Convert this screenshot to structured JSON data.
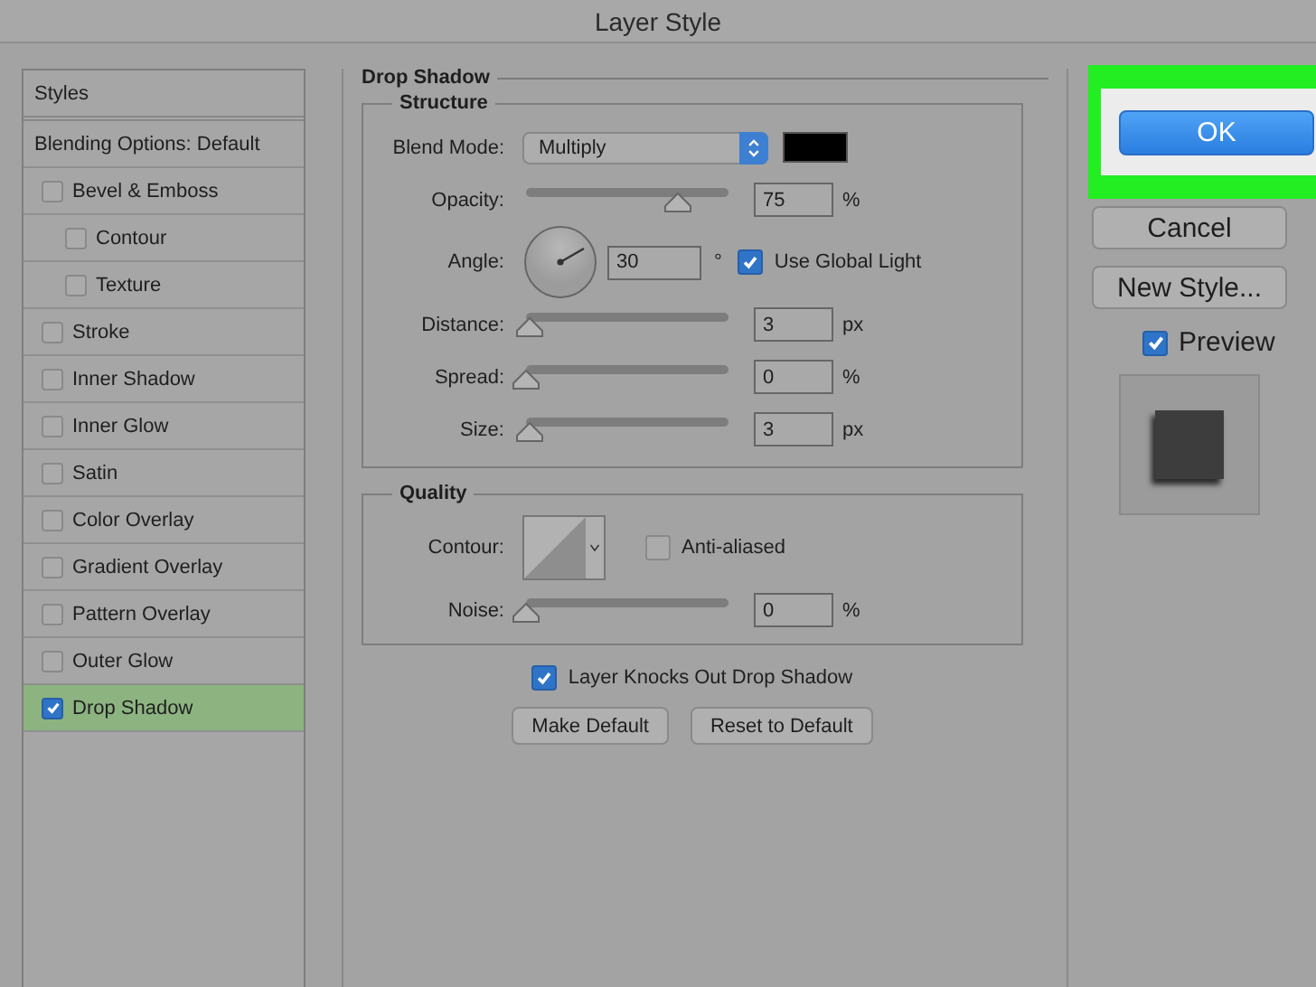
{
  "window": {
    "title": "Layer Style"
  },
  "sidebar": {
    "header": "Styles",
    "items": [
      {
        "label": "Blending Options: Default",
        "kind": "plain",
        "selected": false
      },
      {
        "label": "Bevel & Emboss",
        "kind": "check",
        "checked": false,
        "selected": false,
        "children": [
          {
            "label": "Contour",
            "kind": "check",
            "checked": false,
            "selected": false
          },
          {
            "label": "Texture",
            "kind": "check",
            "checked": false,
            "selected": false
          }
        ]
      },
      {
        "label": "Stroke",
        "kind": "check",
        "checked": false,
        "selected": false
      },
      {
        "label": "Inner Shadow",
        "kind": "check",
        "checked": false,
        "selected": false
      },
      {
        "label": "Inner Glow",
        "kind": "check",
        "checked": false,
        "selected": false
      },
      {
        "label": "Satin",
        "kind": "check",
        "checked": false,
        "selected": false
      },
      {
        "label": "Color Overlay",
        "kind": "check",
        "checked": false,
        "selected": false
      },
      {
        "label": "Gradient Overlay",
        "kind": "check",
        "checked": false,
        "selected": false
      },
      {
        "label": "Pattern Overlay",
        "kind": "check",
        "checked": false,
        "selected": false
      },
      {
        "label": "Outer Glow",
        "kind": "check",
        "checked": false,
        "selected": false
      },
      {
        "label": "Drop Shadow",
        "kind": "check",
        "checked": true,
        "selected": true
      }
    ]
  },
  "drop_shadow": {
    "title": "Drop Shadow",
    "structure": {
      "title": "Structure",
      "rows": [
        {
          "kind": "select",
          "label": "Blend Mode:",
          "value": "Multiply"
        },
        {
          "kind": "slider",
          "label": "Opacity:",
          "level": 0.75,
          "value": "75",
          "unit": "%"
        },
        {
          "kind": "angle",
          "label": "Angle:",
          "value": "30",
          "unit": "°",
          "checkbox": {
            "label": "Use Global Light",
            "checked": true
          }
        },
        {
          "kind": "slider",
          "label": "Distance:",
          "level": 0.02,
          "value": "3",
          "unit": "px"
        },
        {
          "kind": "slider",
          "label": "Spread:",
          "level": 0,
          "value": "0",
          "unit": "%"
        },
        {
          "kind": "slider",
          "label": "Size:",
          "level": 0.02,
          "value": "3",
          "unit": "px"
        }
      ]
    },
    "quality": {
      "title": "Quality",
      "rows": [
        {
          "kind": "contour",
          "label": "Contour:",
          "checkbox": {
            "label": "Anti-aliased",
            "checked": false
          }
        },
        {
          "kind": "slider",
          "label": "Noise:",
          "level": 0,
          "value": "0",
          "unit": "%"
        }
      ]
    },
    "knockout": {
      "label": "Layer Knocks Out Drop Shadow",
      "checked": true
    },
    "buttons": [
      "Make Default",
      "Reset to Default"
    ]
  },
  "actions": [
    {
      "label": "OK",
      "primary": true
    },
    {
      "label": "Cancel",
      "primary": false
    },
    {
      "label": "New Style...",
      "primary": false
    }
  ],
  "preview": {
    "label": "Preview",
    "checked": true
  }
}
